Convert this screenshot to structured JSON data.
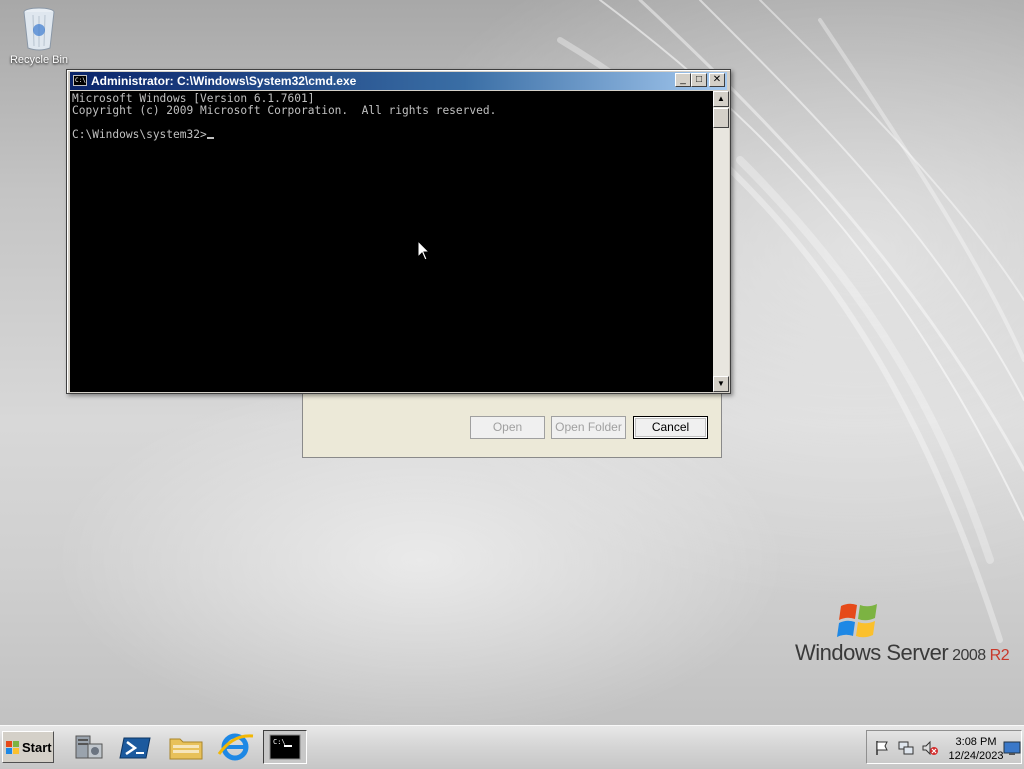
{
  "desktop": {
    "recycle_bin_label": "Recycle Bin"
  },
  "cmd_window": {
    "title": "Administrator: C:\\Windows\\System32\\cmd.exe",
    "title_icon_text": "C:\\",
    "minimize_glyph": "_",
    "maximize_glyph": "□",
    "close_glyph": "✕",
    "console_lines": [
      "Microsoft Windows [Version 6.1.7601]",
      "Copyright (c) 2009 Microsoft Corporation.  All rights reserved.",
      ""
    ],
    "prompt": "C:\\Windows\\system32>",
    "scroll_up_glyph": "▲",
    "scroll_down_glyph": "▼"
  },
  "background_dialog": {
    "open_label": "Open",
    "open_folder_label": "Open Folder",
    "cancel_label": "Cancel"
  },
  "branding": {
    "windows": "Windows Server",
    "year": " 2008",
    "edition": " R2"
  },
  "taskbar": {
    "start_label": "Start",
    "items": [
      {
        "name": "server-manager",
        "icon": "server-manager-icon"
      },
      {
        "name": "powershell",
        "icon": "powershell-icon"
      },
      {
        "name": "explorer",
        "icon": "folder-icon"
      },
      {
        "name": "internet-explorer",
        "icon": "ie-icon"
      },
      {
        "name": "cmd",
        "icon": "cmd-icon",
        "active": true
      }
    ],
    "tray": {
      "time": "3:08 PM",
      "date": "12/24/2023"
    }
  },
  "colors": {
    "titlebar_start": "#0a246a",
    "titlebar_end": "#a6caf0",
    "console_bg": "#000000",
    "console_fg": "#c0c0c0",
    "r2_accent": "#c8382a"
  }
}
